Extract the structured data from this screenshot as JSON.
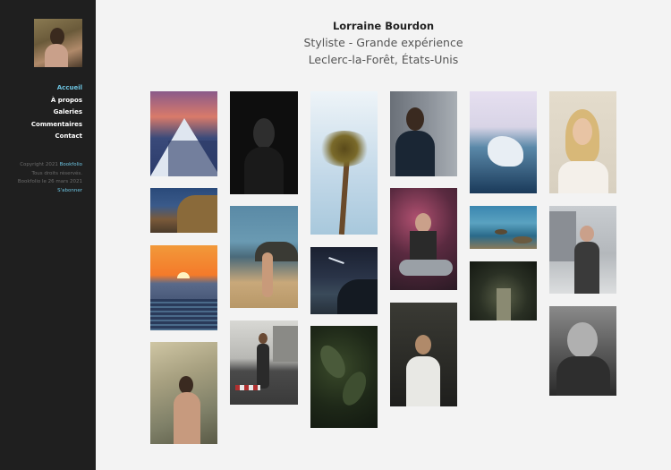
{
  "profile": {
    "name": "Lorraine Bourdon",
    "title": "Styliste - Grande expérience",
    "location": "Leclerc-la-Forêt, États-Unis"
  },
  "nav": {
    "items": [
      {
        "label": "Accueil",
        "active": true
      },
      {
        "label": "À propos",
        "active": false
      },
      {
        "label": "Galeries",
        "active": false
      },
      {
        "label": "Commentaires",
        "active": false
      },
      {
        "label": "Contact",
        "active": false
      }
    ]
  },
  "footer": {
    "copyright_prefix": "Copyright 2021",
    "brand": "Bookfolio",
    "rights": "Tous droits réservés.",
    "built": "Bookfolio le 26 mars 2021",
    "subscribe": "S'abonner"
  },
  "gallery": {
    "photos": [
      {
        "name": "photo-snowy-mountain",
        "subject": "snowy mountain at sunset"
      },
      {
        "name": "photo-rocky-shore",
        "subject": "rocky shore"
      },
      {
        "name": "photo-ocean-sunset",
        "subject": "ocean sunset"
      },
      {
        "name": "photo-woman-reeds",
        "subject": "woman among reeds"
      },
      {
        "name": "photo-man-dark-portrait",
        "subject": "dark portrait of a man"
      },
      {
        "name": "photo-couple-beach",
        "subject": "couple on the beach"
      },
      {
        "name": "photo-woman-street",
        "subject": "woman walking on street"
      },
      {
        "name": "photo-palm-tree",
        "subject": "palm tree"
      },
      {
        "name": "photo-night-coast",
        "subject": "coast at night"
      },
      {
        "name": "photo-leaves",
        "subject": "dark leaves"
      },
      {
        "name": "photo-man-wall",
        "subject": "man leaning on wall"
      },
      {
        "name": "photo-woman-guitar",
        "subject": "woman singing with guitar"
      },
      {
        "name": "photo-tattooed-man",
        "subject": "tattooed man"
      },
      {
        "name": "photo-iceberg",
        "subject": "iceberg"
      },
      {
        "name": "photo-sea-rocks",
        "subject": "rocks in the sea"
      },
      {
        "name": "photo-forest-path",
        "subject": "forest path"
      },
      {
        "name": "photo-blonde-woman",
        "subject": "blonde woman"
      },
      {
        "name": "photo-man-backpack",
        "subject": "man with backpack"
      },
      {
        "name": "photo-old-man",
        "subject": "old man portrait"
      }
    ]
  }
}
